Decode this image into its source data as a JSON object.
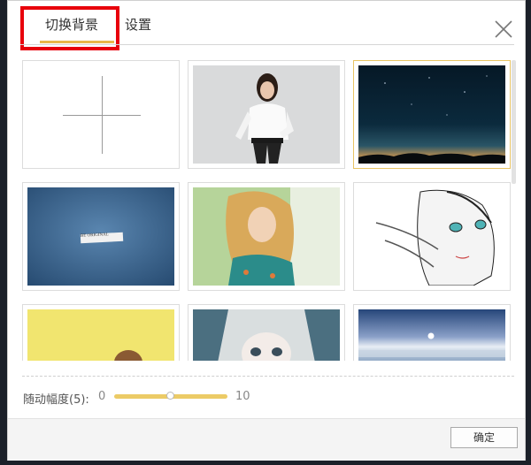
{
  "dialog": {
    "tabs": [
      {
        "label": "切换背景",
        "active": true
      },
      {
        "label": "设置",
        "active": false
      }
    ],
    "close_icon": "close-icon"
  },
  "backgrounds": [
    {
      "name": "add-background",
      "icon": "plus-icon"
    },
    {
      "name": "woman-white-shirt"
    },
    {
      "name": "night-starry-sky",
      "selected": true
    },
    {
      "name": "be-original",
      "caption": "BE ORIGINAL"
    },
    {
      "name": "blonde-woman"
    },
    {
      "name": "anime-boy-sketch"
    },
    {
      "name": "yellow-cartoon"
    },
    {
      "name": "anime-girl"
    },
    {
      "name": "seaside-sunset"
    }
  ],
  "slider": {
    "label": "随动幅度(5):",
    "min_label": "0",
    "max_label": "10",
    "value": 5,
    "min": 0,
    "max": 10
  },
  "footer": {
    "ok_label": "确定"
  },
  "colors": {
    "accent": "#e8b84a",
    "highlight": "#e8000b"
  }
}
